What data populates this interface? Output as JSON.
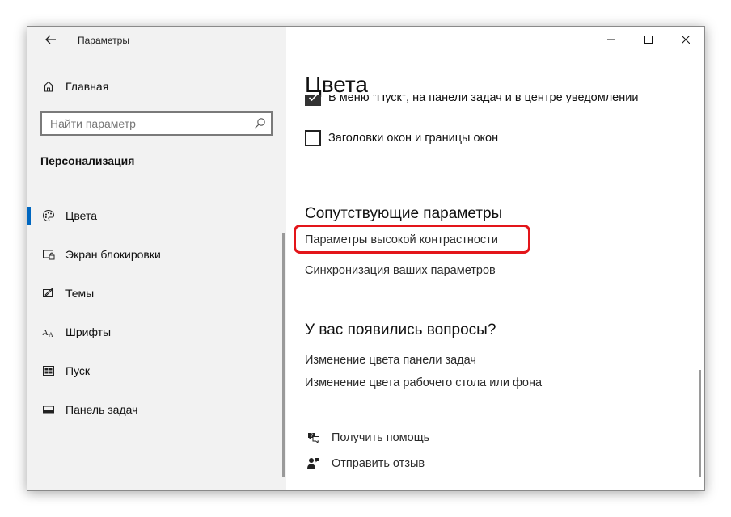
{
  "window": {
    "title": "Параметры",
    "back_icon": "arrow-left-icon"
  },
  "sidebar": {
    "home_label": "Главная",
    "search_placeholder": "Найти параметр",
    "section": "Персонализация",
    "items": [
      {
        "label": "Цвета",
        "icon": "palette-icon",
        "active": true
      },
      {
        "label": "Экран блокировки",
        "icon": "lock-screen-icon",
        "active": false
      },
      {
        "label": "Темы",
        "icon": "themes-icon",
        "active": false
      },
      {
        "label": "Шрифты",
        "icon": "fonts-icon",
        "active": false
      },
      {
        "label": "Пуск",
        "icon": "start-icon",
        "active": false
      },
      {
        "label": "Панель задач",
        "icon": "taskbar-icon",
        "active": false
      }
    ]
  },
  "main": {
    "title": "Цвета",
    "checkboxes": [
      {
        "label": "В меню \"Пуск\", на панели задач и в центре уведомлений",
        "checked": true
      },
      {
        "label": "Заголовки окон и границы окон",
        "checked": false
      }
    ],
    "related": {
      "heading": "Сопутствующие параметры",
      "links": [
        "Параметры высокой контрастности",
        "Синхронизация ваших параметров"
      ]
    },
    "questions": {
      "heading": "У вас появились вопросы?",
      "links": [
        "Изменение цвета панели задач",
        "Изменение цвета рабочего стола или фона"
      ]
    },
    "help": {
      "get_help": "Получить помощь",
      "feedback": "Отправить отзыв"
    }
  },
  "colors": {
    "accent": "#0067c0",
    "highlight": "#e3151a",
    "sidebar_bg": "#f2f2f2"
  }
}
